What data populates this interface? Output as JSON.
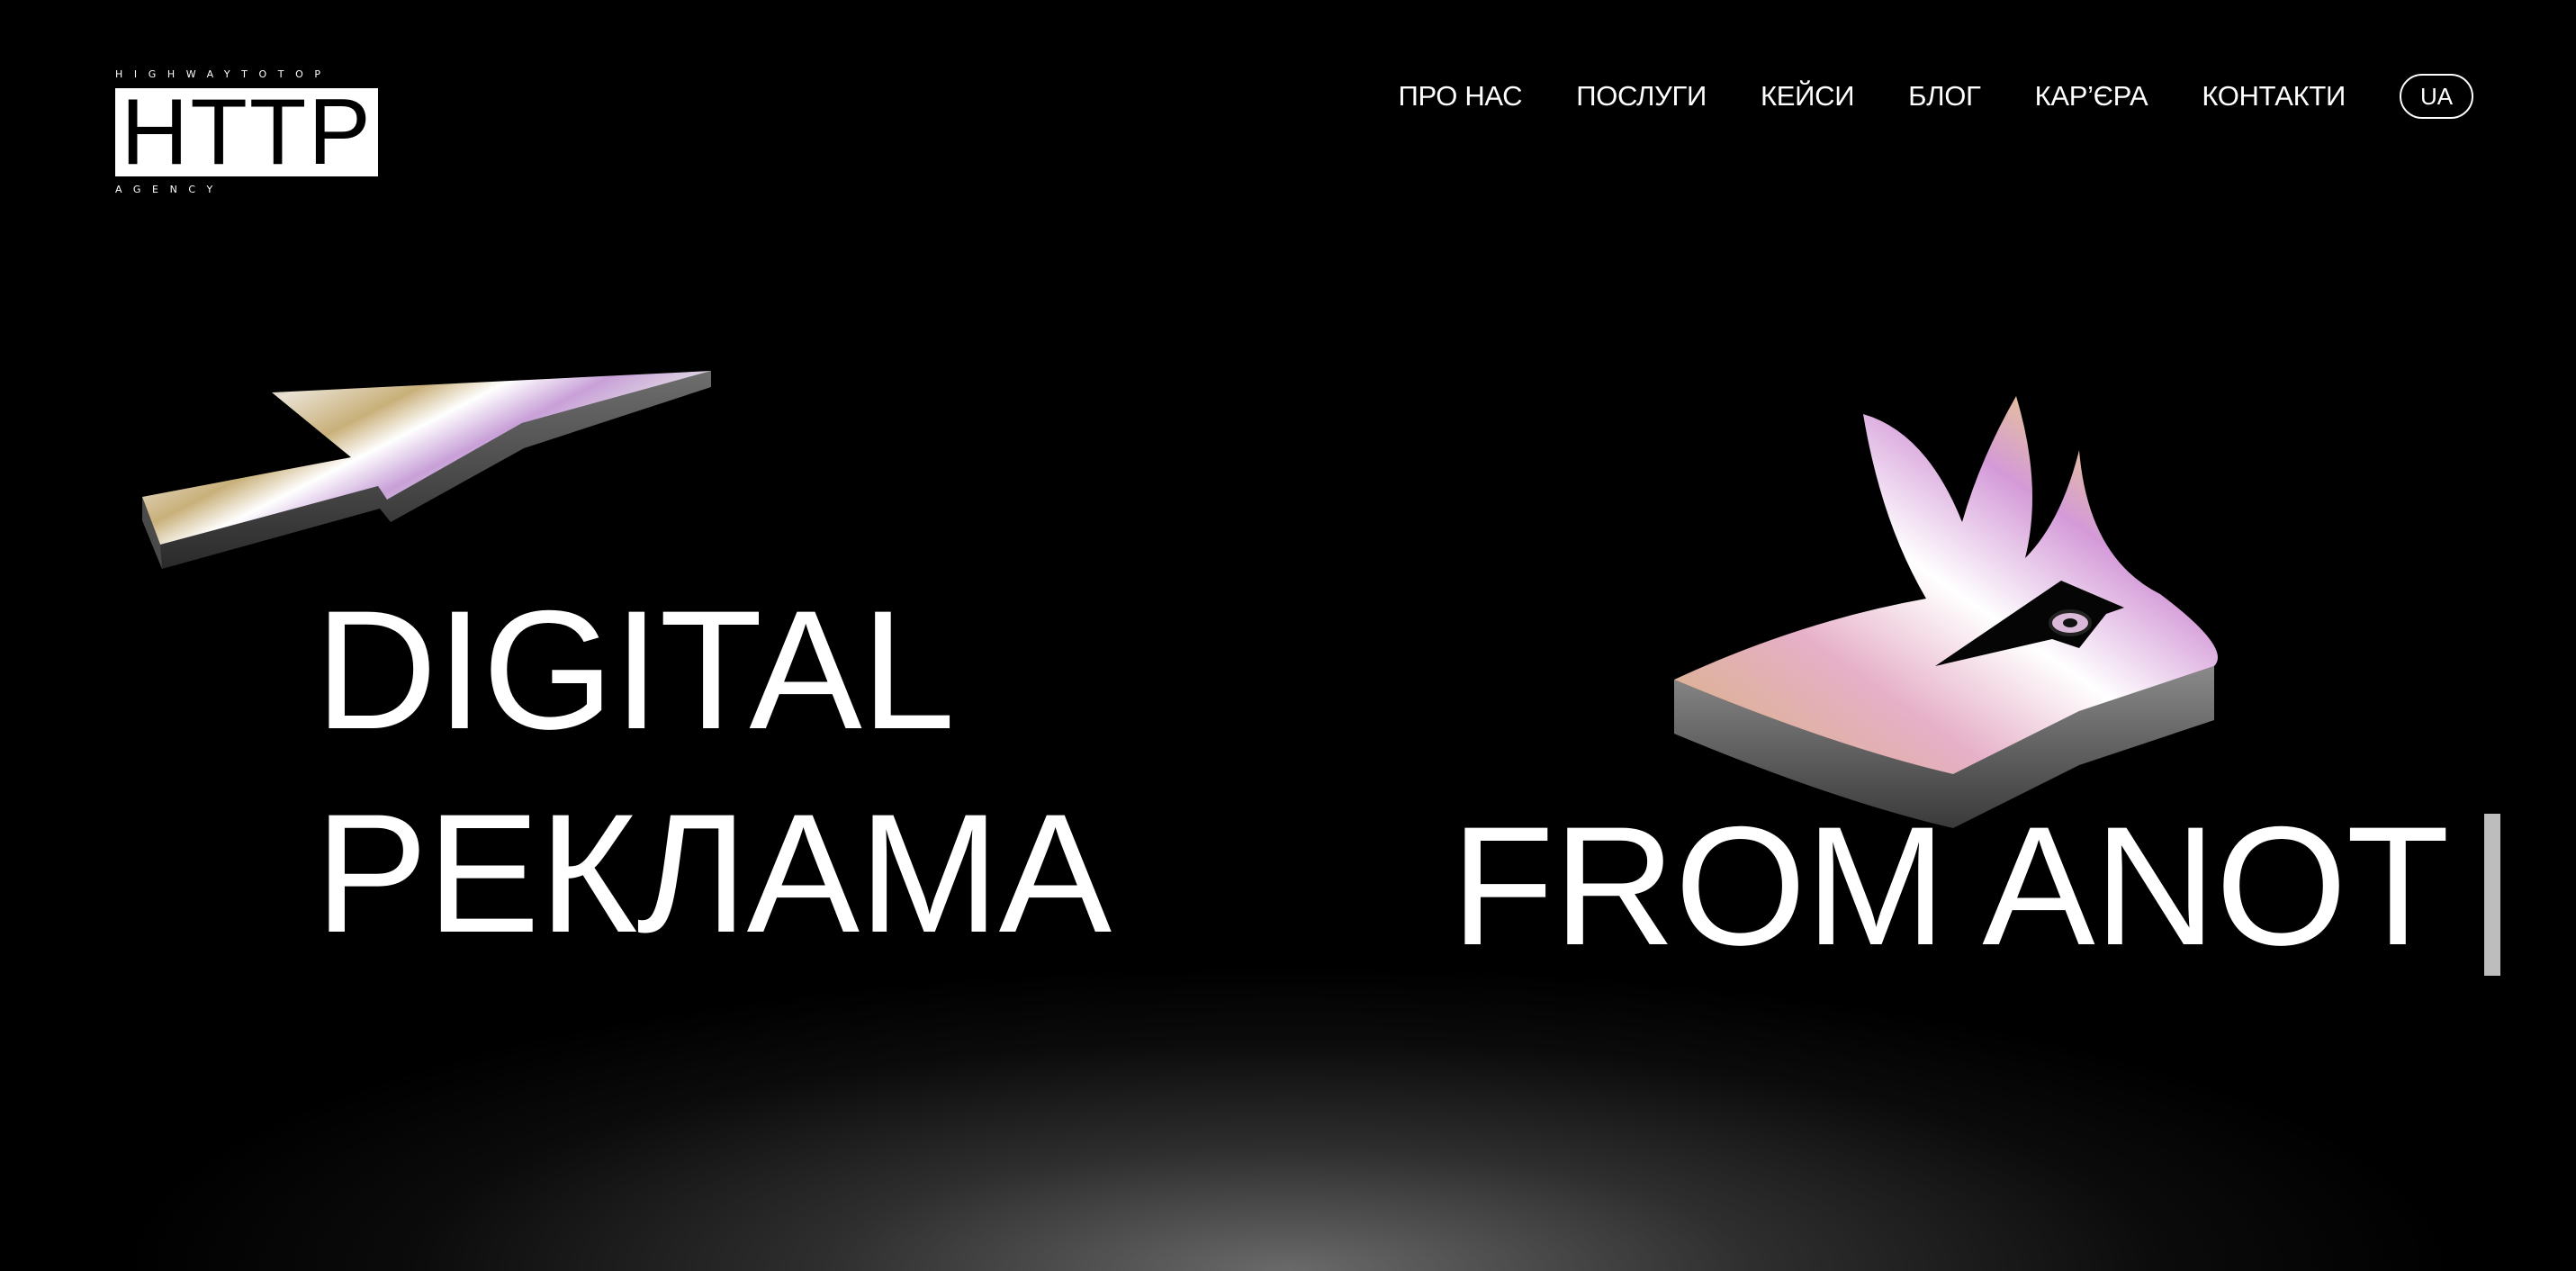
{
  "logo": {
    "tagline_top": "HIGHWAYTOTOP",
    "wordmark": "HTTP",
    "tagline_bottom": "AGENCY"
  },
  "nav": {
    "items": [
      {
        "label": "ПРО НАС"
      },
      {
        "label": "ПОСЛУГИ"
      },
      {
        "label": "КЕЙСИ"
      },
      {
        "label": "БЛОГ"
      },
      {
        "label": "КАР’ЄРА"
      },
      {
        "label": "КОНТАКТИ"
      }
    ],
    "language": "UA"
  },
  "hero": {
    "line1": "DIGITAL",
    "line2": "РЕКЛАМА",
    "line3": "FROM ANOT"
  },
  "illustrations": {
    "left": "cursor-arrow-icon",
    "right": "flame-cursor-icon"
  },
  "colors": {
    "background": "#000000",
    "text": "#ffffff",
    "caret": "#bdbdbd"
  }
}
